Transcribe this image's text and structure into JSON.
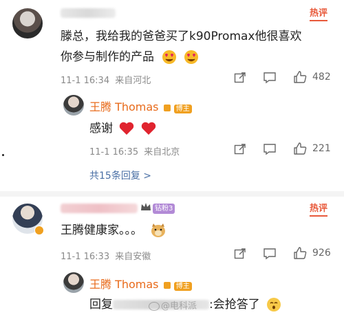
{
  "comments": [
    {
      "hot_tag": "热评",
      "text": "滕总，我给我的爸爸买了k90Promax他很喜欢你参与制作的产品",
      "text_line1": "滕总，我给我的爸爸买了k90Promax他很喜欢",
      "text_line2": "你参与制作的产品",
      "time": "11-1 16:34",
      "location": "来自河北",
      "likes": "482",
      "reply": {
        "author": "王腾 Thomas",
        "badge": "博主",
        "text": "感谢",
        "time": "11-1 16:35",
        "location": "来自北京",
        "likes": "221"
      },
      "more_replies": "共15条回复 >"
    },
    {
      "hot_tag": "热评",
      "fan_badge": "钻粉3",
      "text": "王腾健康家。。。",
      "time": "11-1 16:33",
      "location": "来自安徽",
      "likes": "926",
      "reply": {
        "author": "王腾 Thomas",
        "badge": "博主",
        "text_prefix": "回复",
        "text_suffix": ":会抢答了",
        "watermark": "@电科派"
      }
    }
  ],
  "icons": {
    "share": "share-icon",
    "comment": "comment-icon",
    "like": "thumbs-up-icon",
    "heart": "red-heart-icon",
    "emoji_love": "heart-eyes-emoji-icon",
    "emoji_doge": "doge-emoji-icon",
    "emoji_shush": "shush-emoji-icon",
    "vip": "vip-crown-icon"
  },
  "colors": {
    "hot": "#e8593a",
    "author": "#e86a1a",
    "link": "#4a6fa5",
    "badge": "#f0a020"
  }
}
